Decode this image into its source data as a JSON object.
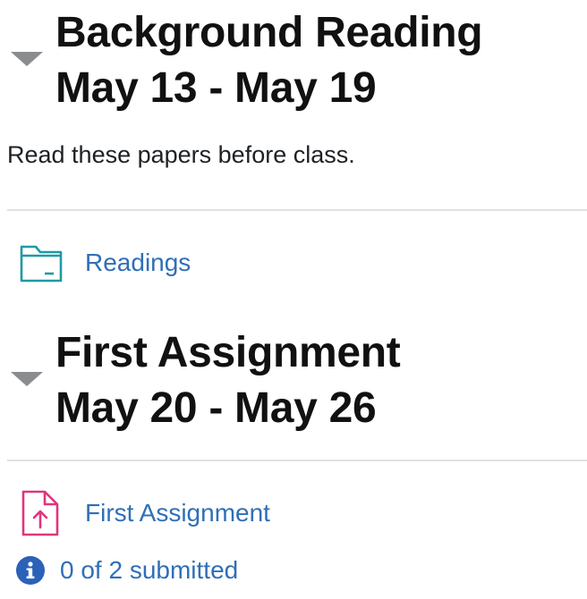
{
  "sections": [
    {
      "title_line1": "Background Reading",
      "title_line2": "May 13 - May 19",
      "summary": "Read these papers before class.",
      "activities": [
        {
          "name": "Readings",
          "icon": "folder-icon"
        }
      ]
    },
    {
      "title_line1": "First Assignment",
      "title_line2": "May 20 - May 26",
      "activities": [
        {
          "name": "First Assignment",
          "icon": "assignment-upload-icon"
        }
      ],
      "status": {
        "text": "0 of 2 submitted",
        "icon": "info-icon"
      }
    }
  ],
  "colors": {
    "link": "#2f6fb7",
    "folder_icon": "#1e9aa5",
    "assignment_icon": "#e0357d",
    "info_icon": "#2b61b8",
    "toggle": "#8a8d90",
    "divider": "#dee2e6"
  }
}
